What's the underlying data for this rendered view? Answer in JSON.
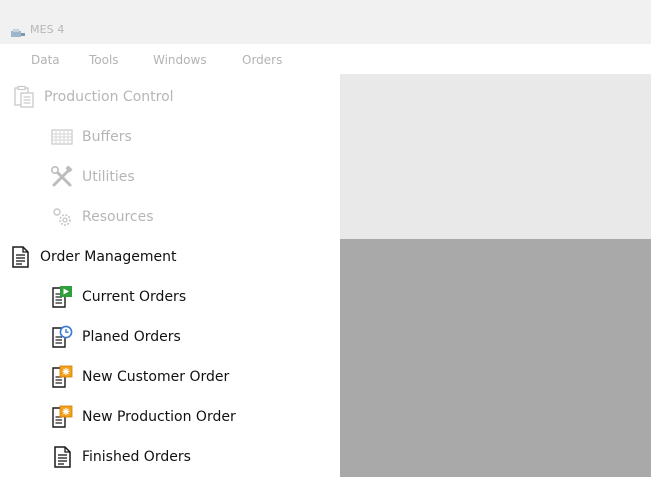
{
  "window": {
    "title": "MES 4",
    "app_icon": "app-logo-icon"
  },
  "menu": {
    "items": [
      "Data",
      "Tools",
      "Windows",
      "Orders"
    ]
  },
  "sidebar": {
    "production_control": {
      "label": "Production Control",
      "icon": "clipboard-icon",
      "enabled": false,
      "children": [
        {
          "label": "Buffers",
          "icon": "grid-icon",
          "enabled": false
        },
        {
          "label": "Utilities",
          "icon": "tools-icon",
          "enabled": false
        },
        {
          "label": "Resources",
          "icon": "gears-icon",
          "enabled": false
        }
      ]
    },
    "order_management": {
      "label": "Order Management",
      "icon": "document-icon",
      "enabled": true,
      "children": [
        {
          "label": "Current Orders",
          "icon": "document-play-icon",
          "enabled": true
        },
        {
          "label": "Planed Orders",
          "icon": "document-clock-icon",
          "enabled": true
        },
        {
          "label": "New Customer Order",
          "icon": "document-new-icon",
          "enabled": true
        },
        {
          "label": "New Production Order",
          "icon": "document-new-icon",
          "enabled": true
        },
        {
          "label": "Finished Orders",
          "icon": "document-icon",
          "enabled": true
        }
      ]
    }
  },
  "colors": {
    "disabled_text": "#b6b6b6",
    "enabled_text": "#111111",
    "content_top": "#e9e9e9",
    "content_bottom": "#a9a9a9",
    "play_green": "#2e9f3a",
    "clock_blue": "#3a7bd5",
    "new_orange": "#f2a11c"
  }
}
